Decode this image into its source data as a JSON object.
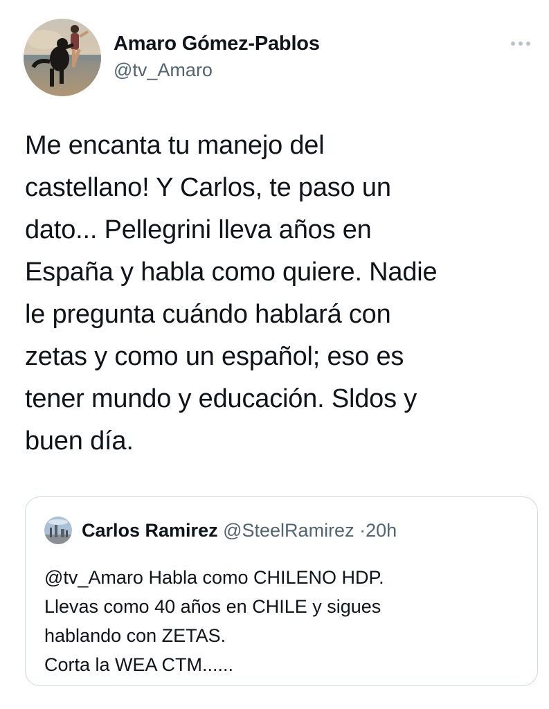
{
  "tweet": {
    "author": {
      "display_name": "Amaro Gómez-Pablos",
      "handle": "@tv_Amaro",
      "avatar_icon": "avatar-beach-dog-photo"
    },
    "more_icon": "more-options-icon",
    "text": "Me encanta tu manejo del\ncastellano! Y Carlos, te paso un\ndato... Pellegrini lleva años en\nEspaña y habla como quiere. Nadie\nle pregunta cuándo hablará con\nzetas y como un español; eso es\ntener mundo y educación. Sldos y\nbuen día."
  },
  "quoted_tweet": {
    "author": {
      "display_name": "Carlos Ramirez",
      "handle": "@SteelRamirez",
      "avatar_icon": "avatar-city-photo"
    },
    "separator": "·",
    "time": "20h",
    "text": "@tv_Amaro Habla como CHILENO HDP.\nLlevas como 40 años en CHILE y sigues\nhablando con ZETAS.\nCorta la WEA CTM......"
  },
  "colors": {
    "text_primary": "#0f1419",
    "text_secondary": "#536471",
    "border": "#cfd9de"
  }
}
